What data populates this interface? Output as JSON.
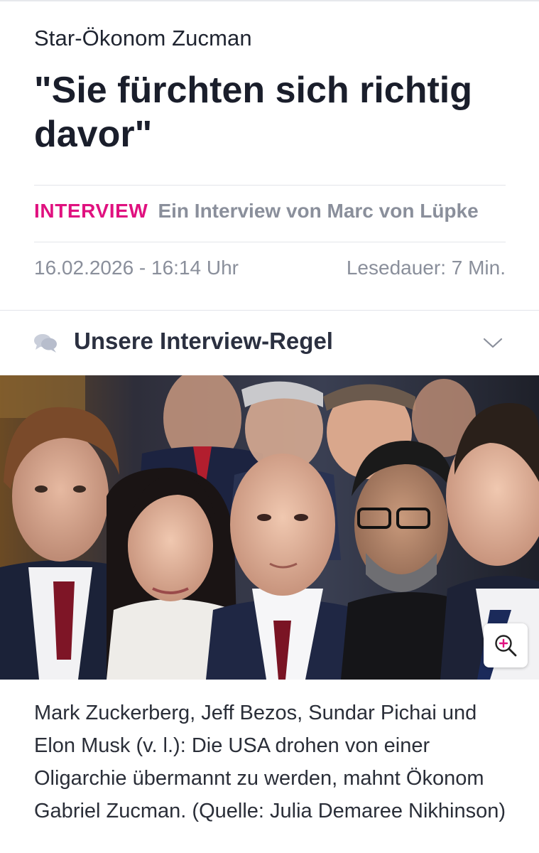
{
  "article": {
    "kicker": "Star-Ökonom Zucman",
    "headline": "\"Sie fürchten sich richtig davor\"",
    "tag": "INTERVIEW",
    "byline": "Ein Interview von Marc von Lüpke",
    "date": "16.02.2026 - 16:14 Uhr",
    "reading_time": "Lesedauer: 7 Min."
  },
  "interview_rule": {
    "label": "Unsere Interview-Regel",
    "icon": "speech-bubbles-icon",
    "toggle_icon": "chevron-down-icon"
  },
  "image": {
    "zoom_icon": "zoom-in-icon",
    "caption": "Mark Zuckerberg, Jeff Bezos, Sundar Pichai und Elon Musk (v. l.): Die USA drohen von einer Oligarchie übermannt zu werden, mahnt Ökonom Gabriel Zucman. (Quelle: Julia Demaree Nikhinson)"
  },
  "colors": {
    "accent": "#e0117f",
    "muted": "#8a8f9b",
    "text": "#1a1e2b"
  }
}
